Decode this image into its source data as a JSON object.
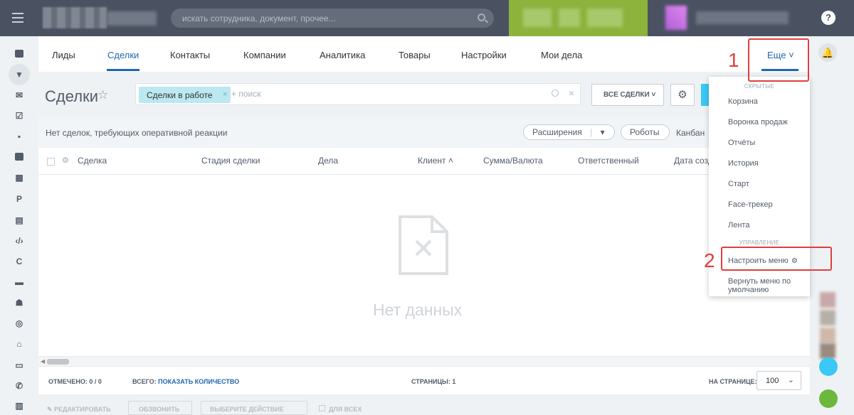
{
  "topbar": {
    "search_placeholder": "искать сотрудника, документ, прочее...",
    "help": "?"
  },
  "left_nav": {
    "letter_p": "P",
    "letter_c": "C"
  },
  "tabs": [
    {
      "label": "Лиды"
    },
    {
      "label": "Сделки"
    },
    {
      "label": "Контакты"
    },
    {
      "label": "Компании"
    },
    {
      "label": "Аналитика"
    },
    {
      "label": "Товары"
    },
    {
      "label": "Настройки"
    },
    {
      "label": "Мои дела"
    }
  ],
  "active_tab": "Сделки",
  "more_tab": {
    "label": "Еще ˅"
  },
  "page": {
    "title": "Сделки",
    "star": "☆"
  },
  "filter": {
    "chip": "Сделки в работе",
    "chip_close": "×",
    "search_placeholder": "+ поиск",
    "clear": "×"
  },
  "buttons": {
    "all_deals": "ВСЕ СДЕЛКИ ˅",
    "settings_gear": "⚙"
  },
  "infobar": {
    "text": "Нет сделок, требующих оперативной реакции",
    "extensions": "Расширения",
    "extensions_arrow": "▾",
    "robots": "Роботы",
    "kanban": "Канбан"
  },
  "grid": {
    "columns": [
      "Сделка",
      "Стадия сделки",
      "Дела",
      "Клиент ˄",
      "Сумма/Валюта",
      "Ответственный",
      "Дата созд"
    ],
    "empty_text": "Нет данных"
  },
  "footer": {
    "marked_label": "ОТМЕЧЕНО:",
    "marked_value": "0 / 0",
    "total_label": "ВСЕГО:",
    "total_link": "ПОКАЗАТЬ КОЛИЧЕСТВО",
    "pages_label": "СТРАНИЦЫ:",
    "pages_value": "1",
    "per_page_label": "НА СТРАНИЦЕ:",
    "per_page_value": "100"
  },
  "actions": {
    "edit": "✎ РЕДАКТИРОВАТЬ",
    "call": "ОБЗВОНИТЬ",
    "select_action": "ВЫБЕРИТЕ ДЕЙСТВИЕ",
    "for_all": "ДЛЯ ВСЕХ"
  },
  "dropdown": {
    "hidden_section": "СКРЫТЫЕ",
    "items": [
      "Корзина",
      "Воронка продаж",
      "Отчёты",
      "История",
      "Старт",
      "Face-трекер",
      "Лента"
    ],
    "manage_section": "УПРАВЛЕНИЕ",
    "configure_menu": "Настроить меню",
    "reset_menu": "Вернуть меню по умолчанию"
  },
  "annotations": {
    "step1": "1",
    "step2": "2"
  },
  "colors": {
    "accent": "#2067b0",
    "topbar": "#4a5262",
    "highlight_red": "#e23d3d",
    "chip": "#bce8f1",
    "green_block": "#8db33c"
  }
}
